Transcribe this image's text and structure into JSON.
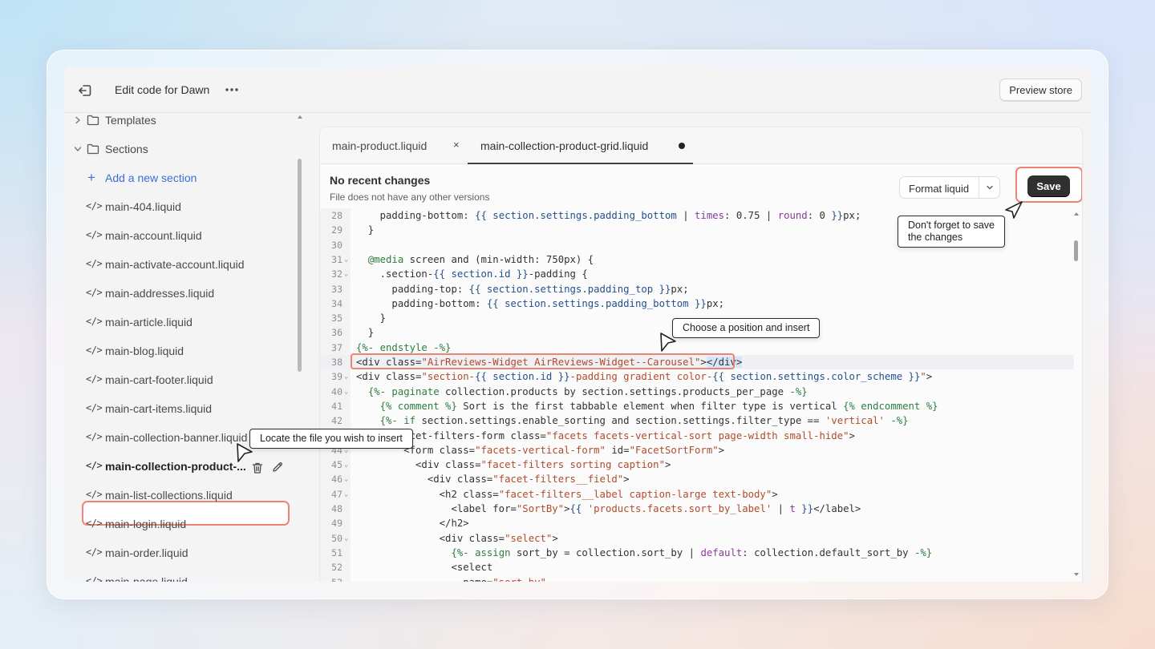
{
  "header": {
    "title": "Edit code for Dawn",
    "preview_label": "Preview store"
  },
  "sidebar": {
    "folders": [
      {
        "label": "Templates",
        "expanded": false
      },
      {
        "label": "Sections",
        "expanded": true
      }
    ],
    "add_label": "Add a new section",
    "files": [
      "main-404.liquid",
      "main-account.liquid",
      "main-activate-account.liquid",
      "main-addresses.liquid",
      "main-article.liquid",
      "main-blog.liquid",
      "main-cart-footer.liquid",
      "main-cart-items.liquid",
      "main-collection-banner.liquid",
      "main-collection-product-...",
      "main-list-collections.liquid",
      "main-login.liquid",
      "main-order.liquid",
      "main-page.liquid"
    ],
    "active_file_index": 9
  },
  "editor": {
    "tabs": [
      {
        "label": "main-product.liquid",
        "close": "×"
      },
      {
        "label": "main-collection-product-grid.liquid",
        "unsaved": true
      }
    ],
    "status_title": "No recent changes",
    "status_sub": "File does not have any other versions",
    "format_label": "Format liquid",
    "save_label": "Save",
    "highlighted_line": 38
  },
  "callouts": {
    "save": "Don't forget to save\nthe changes",
    "insert": "Choose a position and insert",
    "locate": "Locate the file you wish to insert"
  },
  "colors": {
    "highlight_border": "#ec8473",
    "save_button": "#303030",
    "link_blue": "#3b6fd6"
  }
}
